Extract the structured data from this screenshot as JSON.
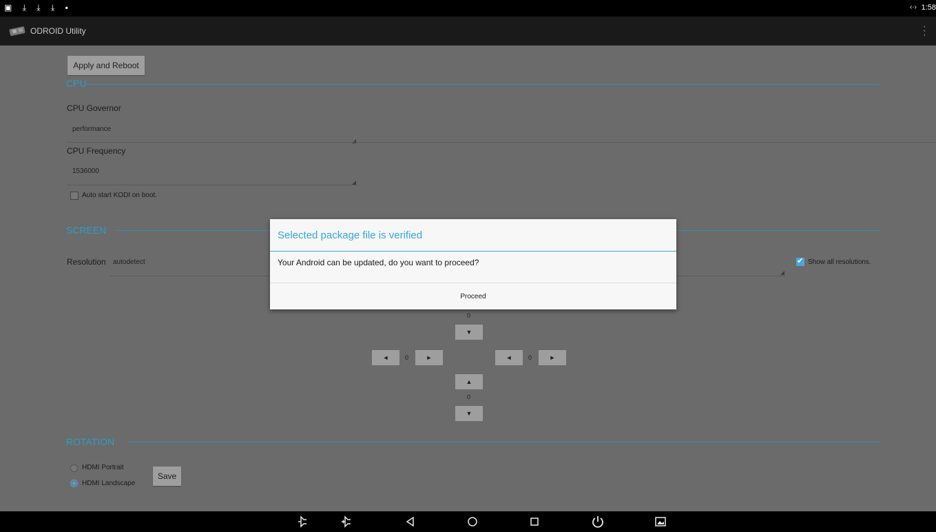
{
  "statusbar": {
    "left_icons": "▣ ⤓ ⤓ ⤓ ▪",
    "signal": "‹·›",
    "clock": "1:58"
  },
  "app": {
    "title": "ODROID Utility"
  },
  "toolbar": {
    "apply_label": "Apply and Reboot"
  },
  "cpu": {
    "section_title": "CPU",
    "governor_label": "CPU Governor",
    "governor_value": "performance",
    "frequency_label": "CPU Frequency",
    "frequency_value": "1536000",
    "kodi_checkbox_label": "Auto start KODI on boot.",
    "kodi_checked": false
  },
  "screen": {
    "section_title": "SCREEN",
    "resolution_label": "Resolution",
    "resolution_value": "autodetect",
    "show_all_label": "Show all resolutions.",
    "show_all_checked": true,
    "offsets": {
      "top": "0",
      "left": "0",
      "right": "0",
      "bottom": "0"
    },
    "up_arrow": "▲",
    "down_arrow": "▼",
    "left_arrow": "◄",
    "right_arrow": "►"
  },
  "rotation": {
    "section_title": "ROTATION",
    "options": [
      "HDMI Portrait",
      "HDMI Landscape"
    ],
    "selected": "HDMI Landscape",
    "save_label": "Save"
  },
  "dialog": {
    "title": "Selected package file is verified",
    "message": "Your Android can be updated, do you want to proceed?",
    "proceed_label": "Proceed"
  },
  "colors": {
    "accent": "#33a8d8",
    "background": "#6b6b6b"
  }
}
